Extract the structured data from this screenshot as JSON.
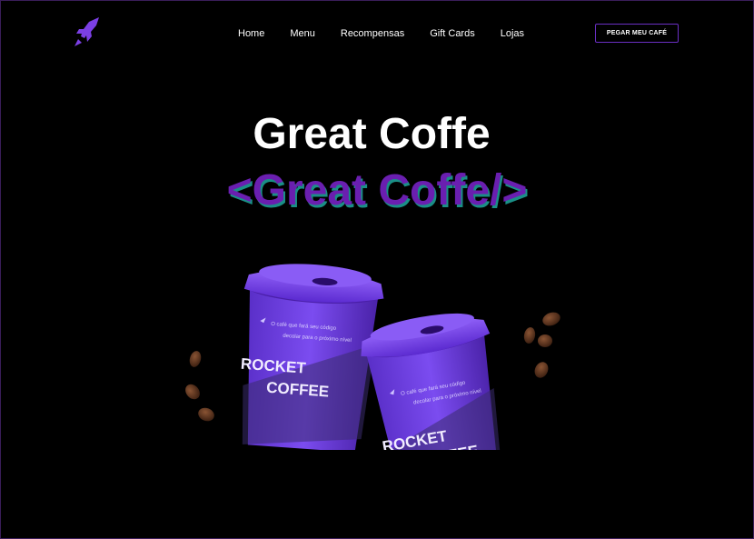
{
  "brand": {
    "logo_icon": "rocket-icon",
    "accent_color": "#7b3fe4",
    "subtitle_color": "#6a1fb0",
    "shadow_color": "#1a8f86"
  },
  "nav": {
    "items": [
      {
        "label": "Home"
      },
      {
        "label": "Menu"
      },
      {
        "label": "Recompensas"
      },
      {
        "label": "Gift Cards"
      },
      {
        "label": "Lojas"
      }
    ],
    "cta_label": "PEGAR MEU CAFÉ"
  },
  "hero": {
    "title": "Great Coffe",
    "subtitle": "<Great Coffe/>",
    "cup_left": {
      "brand_line1": "ROCKET",
      "brand_line2": "COFFEE",
      "tagline_line1": "O café que fará seu código",
      "tagline_line2": "decolar para o próximo nível"
    },
    "cup_right": {
      "brand_line1": "ROCKET",
      "brand_line2": "COFFEE",
      "tagline_line1": "O café que fará seu código",
      "tagline_line2": "decolar para o próximo nível"
    }
  }
}
